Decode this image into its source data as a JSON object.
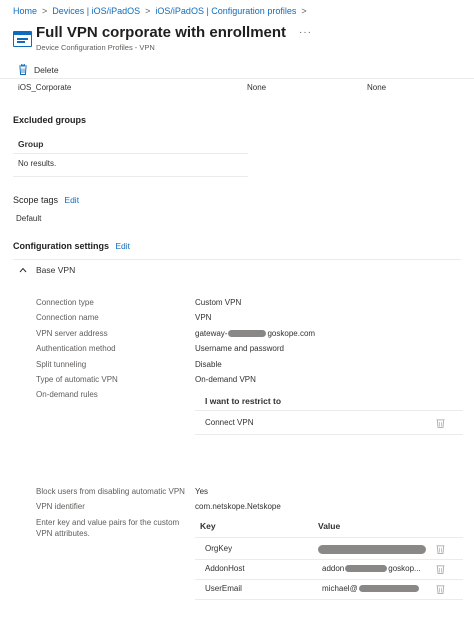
{
  "breadcrumb": {
    "items": [
      "Home",
      "Devices | iOS/iPadOS",
      "iOS/iPadOS | Configuration profiles"
    ],
    "separator": ">"
  },
  "header": {
    "title": "Full VPN corporate with enrollment",
    "more": "···",
    "subtitle": "Device Configuration Profiles - VPN"
  },
  "toolbar": {
    "delete_label": "Delete"
  },
  "included_row": {
    "name": "iOS_Corporate",
    "col2": "None",
    "col3": "None"
  },
  "excluded": {
    "heading": "Excluded groups",
    "column": "Group",
    "empty": "No results."
  },
  "scope": {
    "heading": "Scope tags",
    "edit": "Edit",
    "value": "Default"
  },
  "config": {
    "heading": "Configuration settings",
    "edit": "Edit",
    "section": "Base VPN",
    "settings": [
      {
        "label": "Connection type",
        "value": "Custom VPN"
      },
      {
        "label": "Connection name",
        "value": "VPN"
      },
      {
        "label": "VPN server address",
        "value": "gateway-",
        "value_suffix": "goskope.com"
      },
      {
        "label": "Authentication method",
        "value": "Username and password"
      },
      {
        "label": "Split tunneling",
        "value": "Disable"
      },
      {
        "label": "Type of automatic VPN",
        "value": "On-demand VPN"
      },
      {
        "label": "On-demand rules",
        "value": ""
      }
    ],
    "ondemand": {
      "header": "I want to restrict to",
      "rows": [
        "Connect VPN"
      ]
    },
    "block_label": "Block users from disabling automatic VPN",
    "block_value": "Yes",
    "vpn_id_label": "VPN identifier",
    "vpn_id_value": "com.netskope.Netskope",
    "kv_label": "Enter key and value pairs for the custom VPN attributes.",
    "kv": {
      "key_header": "Key",
      "value_header": "Value",
      "rows": [
        {
          "key": "OrgKey",
          "value": ""
        },
        {
          "key": "AddonHost",
          "value_prefix": "addon",
          "value_suffix": "goskop..."
        },
        {
          "key": "UserEmail",
          "value_prefix": "michael@",
          "value_suffix": ""
        }
      ]
    }
  },
  "colors": {
    "link": "#0f6cbd",
    "text": "#323130",
    "muted": "#605e5c",
    "divider": "#edebe9"
  }
}
